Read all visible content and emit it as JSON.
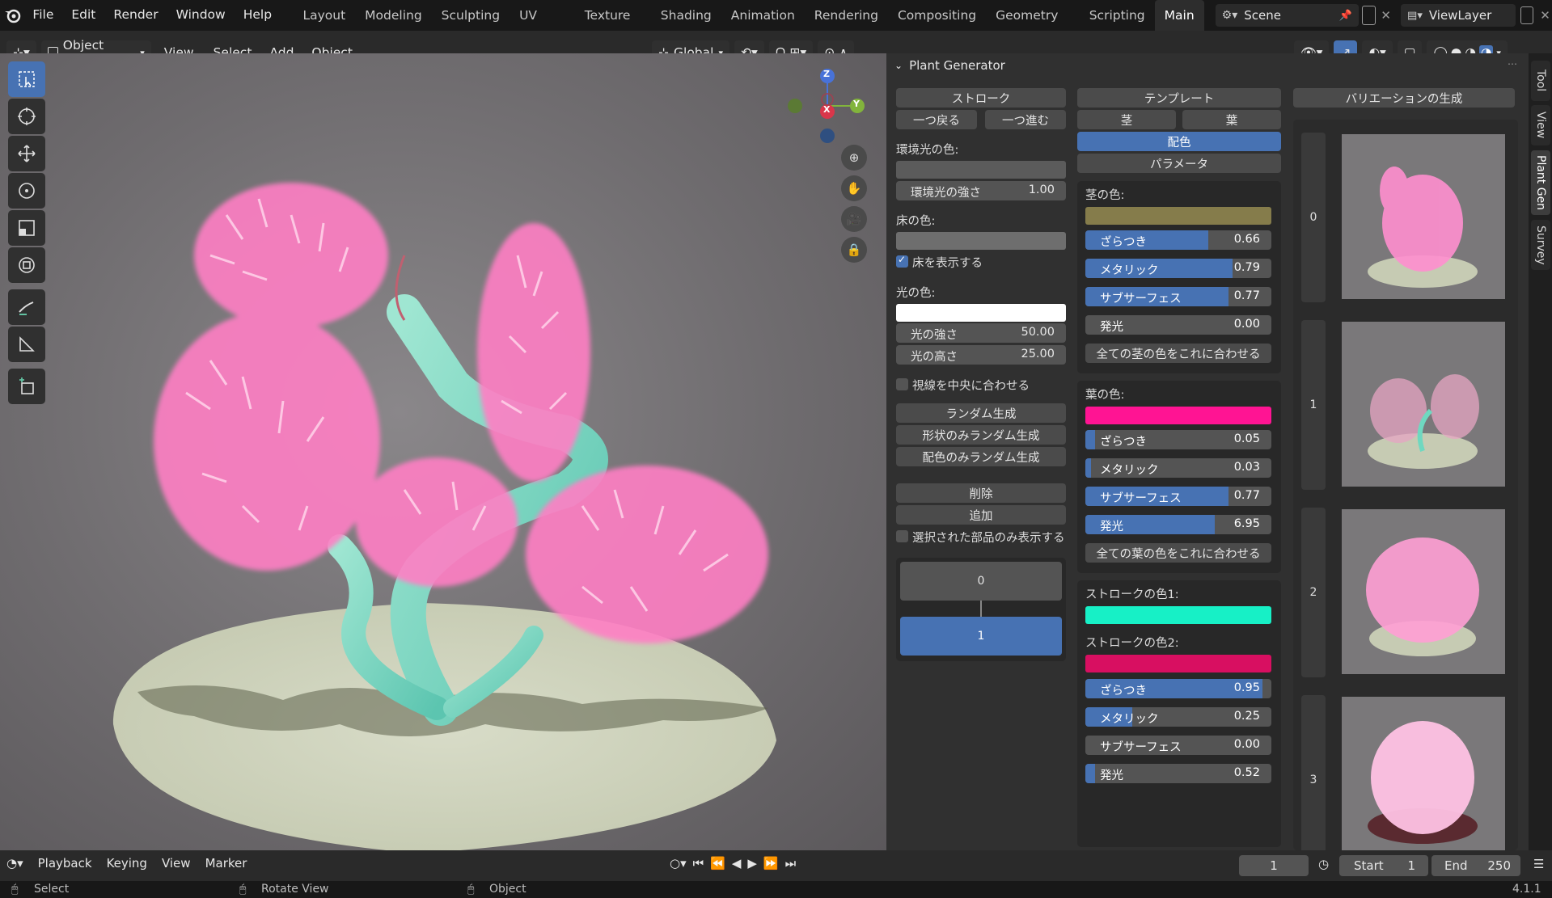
{
  "topbar": {
    "menus": [
      "File",
      "Edit",
      "Render",
      "Window",
      "Help"
    ],
    "workspaces": [
      "Layout",
      "Modeling",
      "Sculpting",
      "UV Editing",
      "Texture Paint",
      "Shading",
      "Animation",
      "Rendering",
      "Compositing",
      "Geometry Nodes",
      "Scripting",
      "Main"
    ],
    "active_workspace": "Main",
    "scene": "Scene",
    "view_layer": "ViewLayer"
  },
  "header": {
    "mode": "Object Mode",
    "menus": [
      "View",
      "Select",
      "Add",
      "Object"
    ],
    "transform_orientation": "Global"
  },
  "gizmo": {
    "z": "Z",
    "y": "Y",
    "x": "X"
  },
  "panel": {
    "title": "Plant Generator",
    "col1": {
      "stroke": "ストローク",
      "undo": "一つ戻る",
      "redo": "一つ進む",
      "ambient_color_label": "環境光の色:",
      "ambient_strength_label": "環境光の強さ",
      "ambient_strength_value": "1.00",
      "floor_color_label": "床の色:",
      "show_floor": "床を表示する",
      "light_color_label": "光の色:",
      "light_strength_label": "光の強さ",
      "light_strength_value": "50.00",
      "light_height_label": "光の高さ",
      "light_height_value": "25.00",
      "center_view": "視線を中央に合わせる",
      "random": "ランダム生成",
      "random_shape": "形状のみランダム生成",
      "random_color": "配色のみランダム生成",
      "delete": "削除",
      "add": "追加",
      "show_selected": "選択された部品のみ表示する",
      "layer0": "0",
      "layer1": "1",
      "colors": {
        "ambient": "#5b5b5b",
        "floor": "#6e6e6e",
        "light": "#ffffff"
      }
    },
    "col2": {
      "template": "テンプレート",
      "stem": "茎",
      "leaf": "葉",
      "coloring": "配色",
      "params": "パラメータ",
      "stem_color_label": "茎の色:",
      "stem_color": "#857c4b",
      "stem_sliders": [
        {
          "label": "ざらつき",
          "value": "0.66",
          "fraction": 0.66,
          "highlight": true
        },
        {
          "label": "メタリック",
          "value": "0.79",
          "fraction": 0.79,
          "highlight": true
        },
        {
          "label": "サブサーフェス",
          "value": "0.77",
          "fraction": 0.77,
          "highlight": true
        },
        {
          "label": "発光",
          "value": "0.00",
          "fraction": 0.0,
          "highlight": false
        }
      ],
      "apply_stem": "全ての茎の色をこれに合わせる",
      "leaf_color_label": "葉の色:",
      "leaf_color": "#ff1493",
      "leaf_sliders": [
        {
          "label": "ざらつき",
          "value": "0.05",
          "fraction": 0.05,
          "highlight": false
        },
        {
          "label": "メタリック",
          "value": "0.03",
          "fraction": 0.03,
          "highlight": false
        },
        {
          "label": "サブサーフェス",
          "value": "0.77",
          "fraction": 0.77,
          "highlight": true
        },
        {
          "label": "発光",
          "value": "6.95",
          "fraction": 0.695,
          "highlight": true
        }
      ],
      "apply_leaf": "全ての葉の色をこれに合わせる",
      "stroke_color1_label": "ストロークの色1:",
      "stroke_color1": "#17f0c6",
      "stroke_color2_label": "ストロークの色2:",
      "stroke_color2": "#d80f61",
      "stroke_sliders": [
        {
          "label": "ざらつき",
          "value": "0.95",
          "fraction": 0.95,
          "highlight": true
        },
        {
          "label": "メタリック",
          "value": "0.25",
          "fraction": 0.25,
          "highlight": false
        },
        {
          "label": "サブサーフェス",
          "value": "0.00",
          "fraction": 0.0,
          "highlight": false
        },
        {
          "label": "発光",
          "value": "0.52",
          "fraction": 0.052,
          "highlight": false
        }
      ]
    },
    "col3": {
      "variations": "バリエーションの生成",
      "items": [
        "0",
        "1",
        "2",
        "3"
      ]
    }
  },
  "side_tabs": [
    "Tool",
    "View",
    "Plant Gen",
    "Survey"
  ],
  "timeline": {
    "playback": "Playback",
    "keying": "Keying",
    "view": "View",
    "marker": "Marker",
    "current_frame": "1",
    "start_label": "Start",
    "start": "1",
    "end_label": "End",
    "end": "250"
  },
  "status": {
    "select": "Select",
    "rotate": "Rotate View",
    "object": "Object",
    "version": "4.1.1"
  }
}
